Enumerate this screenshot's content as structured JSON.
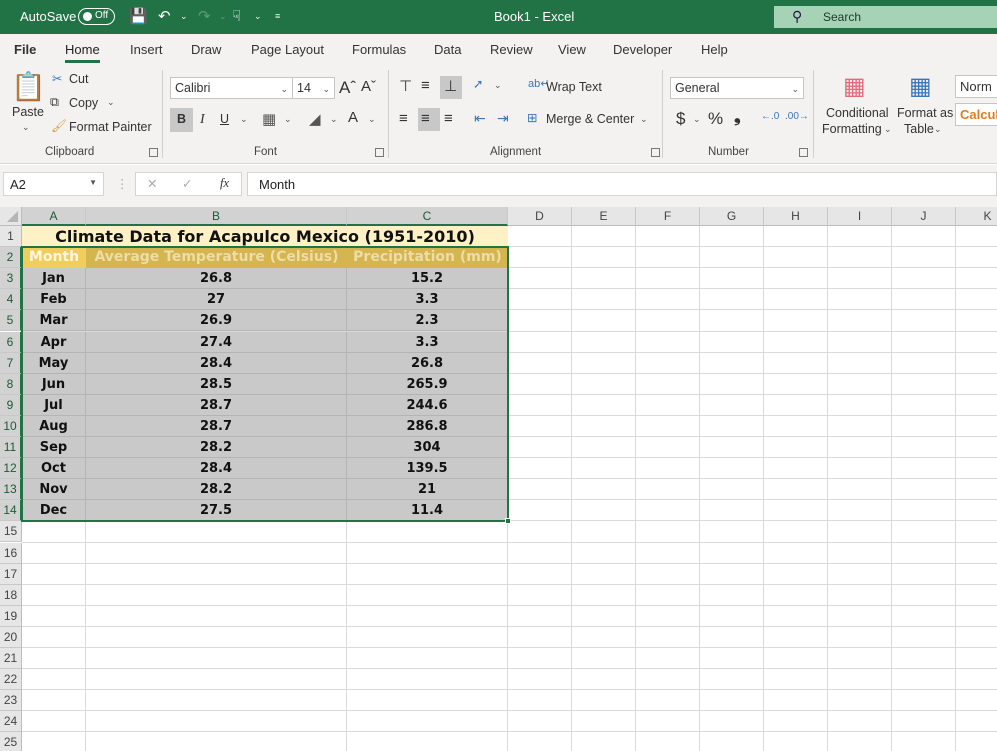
{
  "titlebar": {
    "autosave_label": "AutoSave",
    "autosave_state": "Off",
    "document_title": "Book1  -  Excel",
    "search_placeholder": "Search"
  },
  "tabs": [
    "File",
    "Home",
    "Insert",
    "Draw",
    "Page Layout",
    "Formulas",
    "Data",
    "Review",
    "View",
    "Developer",
    "Help"
  ],
  "active_tab": "Home",
  "ribbon": {
    "clipboard": {
      "label": "Clipboard",
      "paste": "Paste",
      "cut": "Cut",
      "copy": "Copy",
      "format_painter": "Format Painter"
    },
    "font": {
      "label": "Font",
      "font_name": "Calibri",
      "font_size": "14",
      "bold": "B",
      "italic": "I",
      "underline": "U",
      "font_color": "A"
    },
    "alignment": {
      "label": "Alignment",
      "wrap_text": "Wrap Text",
      "merge_center": "Merge & Center"
    },
    "number": {
      "label": "Number",
      "format": "General",
      "currency": "$",
      "percent": "%",
      "comma": "❟"
    },
    "styles": {
      "conditional_formatting_1": "Conditional",
      "conditional_formatting_2": "Formatting",
      "format_as_table_1": "Format as",
      "format_as_table_2": "Table",
      "style_normal": "Norm",
      "style_calc": "Calcul"
    }
  },
  "formula_bar": {
    "name_box": "A2",
    "cancel": "✕",
    "enter": "✓",
    "fx": "fx",
    "content": "Month"
  },
  "columns": [
    "A",
    "B",
    "C",
    "D",
    "E",
    "F",
    "G",
    "H",
    "I",
    "J",
    "K"
  ],
  "rows": [
    "1",
    "2",
    "3",
    "4",
    "5",
    "6",
    "7",
    "8",
    "9",
    "10",
    "11",
    "12",
    "13",
    "14",
    "15",
    "16",
    "17",
    "18",
    "19",
    "20",
    "21",
    "22",
    "23",
    "24",
    "25"
  ],
  "sheet": {
    "title": "Climate Data for Acapulco Mexico (1951-2010)",
    "headers": [
      "Month",
      "Average Temperature (Celsius)",
      "Precipitation (mm)"
    ],
    "data": [
      [
        "Jan",
        "26.8",
        "15.2"
      ],
      [
        "Feb",
        "27",
        "3.3"
      ],
      [
        "Mar",
        "26.9",
        "2.3"
      ],
      [
        "Apr",
        "27.4",
        "3.3"
      ],
      [
        "May",
        "28.4",
        "26.8"
      ],
      [
        "Jun",
        "28.5",
        "265.9"
      ],
      [
        "Jul",
        "28.7",
        "244.6"
      ],
      [
        "Aug",
        "28.7",
        "286.8"
      ],
      [
        "Sep",
        "28.2",
        "304"
      ],
      [
        "Oct",
        "28.4",
        "139.5"
      ],
      [
        "Nov",
        "28.2",
        "21"
      ],
      [
        "Dec",
        "27.5",
        "11.4"
      ]
    ]
  },
  "colors": {
    "brand": "#217346",
    "title_fill": "#fff1c6",
    "header_fill": "#d5b54f",
    "data_fill": "#c9c9c9"
  }
}
